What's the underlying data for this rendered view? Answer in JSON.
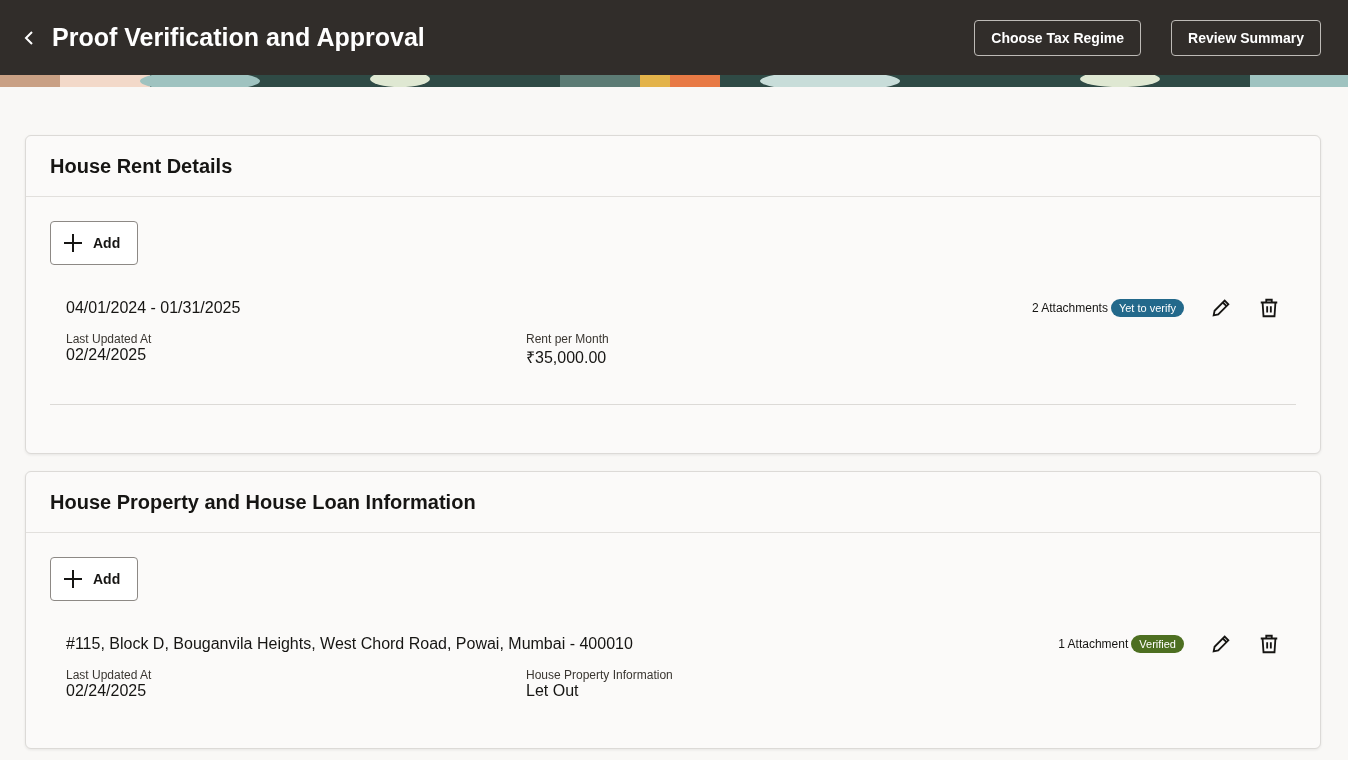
{
  "header": {
    "title": "Proof Verification and Approval",
    "buttons": [
      "Choose Tax Regime",
      "Review Summary"
    ]
  },
  "sections": [
    {
      "title": "House Rent Details",
      "add_label": "Add",
      "records": [
        {
          "heading": "04/01/2024 - 01/31/2025",
          "attachments": "2 Attachments",
          "status": {
            "kind": "pending",
            "label": "Yet to verify"
          },
          "fields": [
            {
              "label": "Last Updated At",
              "value": "02/24/2025"
            },
            {
              "label": "Rent per Month",
              "value": "₹35,000.00"
            }
          ]
        }
      ],
      "divider": true
    },
    {
      "title": "House Property and House Loan Information",
      "add_label": "Add",
      "records": [
        {
          "heading": "#115, Block D, Bouganvila Heights, West Chord Road, Powai, Mumbai - 400010",
          "attachments": "1 Attachment",
          "status": {
            "kind": "verified",
            "label": "Verified"
          },
          "fields": [
            {
              "label": "Last Updated At",
              "value": "02/24/2025"
            },
            {
              "label": "House Property Information",
              "value": "Let Out"
            }
          ]
        }
      ],
      "divider": false
    }
  ]
}
